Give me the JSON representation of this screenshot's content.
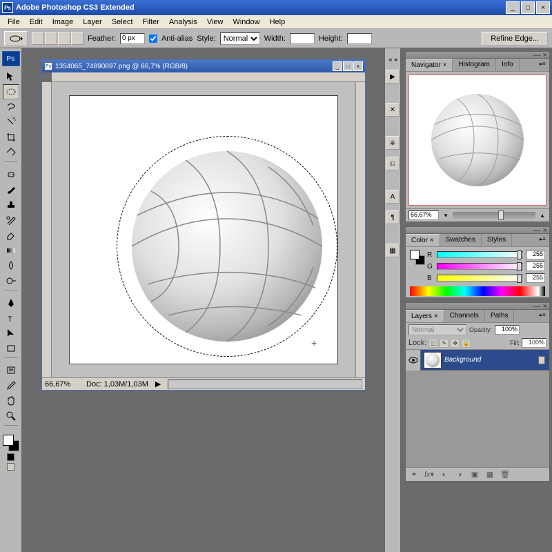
{
  "app": {
    "title": "Adobe Photoshop CS3 Extended"
  },
  "menu": [
    "File",
    "Edit",
    "Image",
    "Layer",
    "Select",
    "Filter",
    "Analysis",
    "View",
    "Window",
    "Help"
  ],
  "options": {
    "feather_label": "Feather:",
    "feather_value": "0 px",
    "antialias_label": "Anti-alias",
    "style_label": "Style:",
    "style_value": "Normal",
    "width_label": "Width:",
    "height_label": "Height:",
    "refine_label": "Refine Edge..."
  },
  "document": {
    "title": "1354065_74890897.png @ 66,7% (RGB/8)",
    "zoom": "66,67%",
    "doc_size": "Doc: 1,03M/1,03M"
  },
  "navigator": {
    "tabs": [
      "Navigator ×",
      "Histogram",
      "Info"
    ],
    "zoom": "66.67%"
  },
  "color": {
    "tabs": [
      "Color ×",
      "Swatches",
      "Styles"
    ],
    "r": "255",
    "g": "255",
    "b": "255",
    "r_label": "R",
    "g_label": "G",
    "b_label": "B"
  },
  "layers": {
    "tabs": [
      "Layers ×",
      "Channels",
      "Paths"
    ],
    "blend": "Normal",
    "opacity_label": "Opacity:",
    "opacity": "100%",
    "lock_label": "Lock:",
    "fill_label": "Fill:",
    "fill": "100%",
    "bg_name": "Background"
  }
}
